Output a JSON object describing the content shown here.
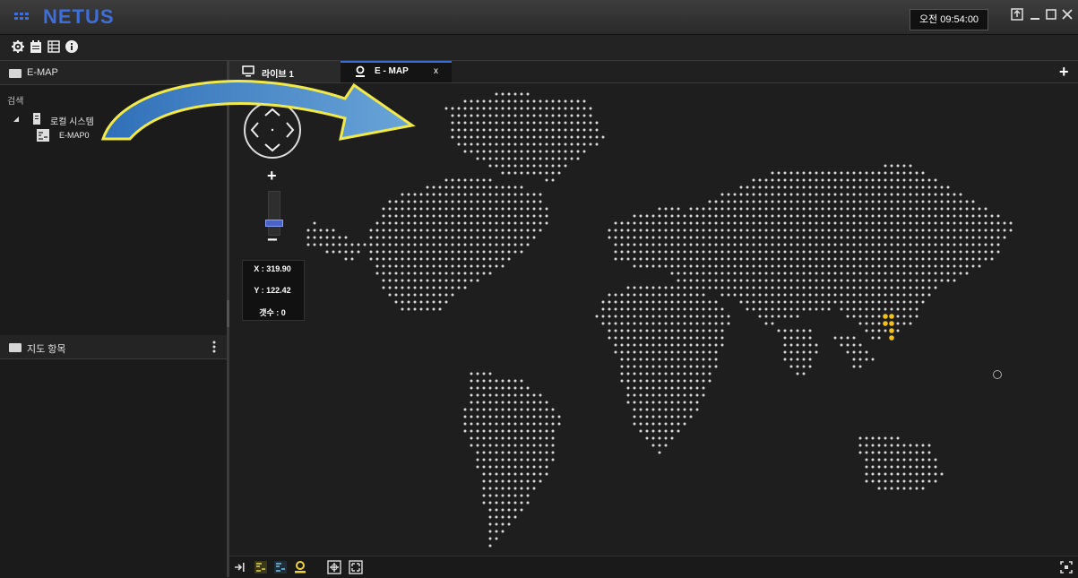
{
  "app": {
    "title": "NETUS",
    "clock": "오전 09:54:00"
  },
  "window_controls": [
    "export-icon",
    "minimize-icon",
    "maximize-icon",
    "close-icon"
  ],
  "toolbar": {
    "icons": [
      "settings-icon",
      "calendar-icon",
      "list-icon",
      "info-icon"
    ]
  },
  "left_panel": {
    "emap_header": "E-MAP",
    "search_label": "검색",
    "tree": {
      "root_label": "로컬 시스템",
      "child_label": "E-MAP0"
    },
    "map_items_header": "지도 항목"
  },
  "tabs": [
    {
      "label": "라이브 1",
      "icon": "monitor-icon",
      "active": false
    },
    {
      "label": "E - MAP",
      "icon": "pin-icon",
      "active": true,
      "close": "x"
    }
  ],
  "add_tab": "+",
  "map": {
    "zoom_in": "+",
    "zoom_out": "−",
    "x_readout": "X : 319.90",
    "y_readout": "Y : 122.42",
    "count_readout": "갯수 : 0",
    "zoom_level": 0.25,
    "dot_color": "#d9d9d9",
    "highlight_color": "#f2c21b"
  },
  "bottom_toolbar": {
    "icons": [
      "collapse-icon",
      "move-in-icon",
      "move-out-icon",
      "add-marker-icon",
      "fit-icon",
      "fullscreen-icon"
    ]
  },
  "accent": "#3f6ed8"
}
